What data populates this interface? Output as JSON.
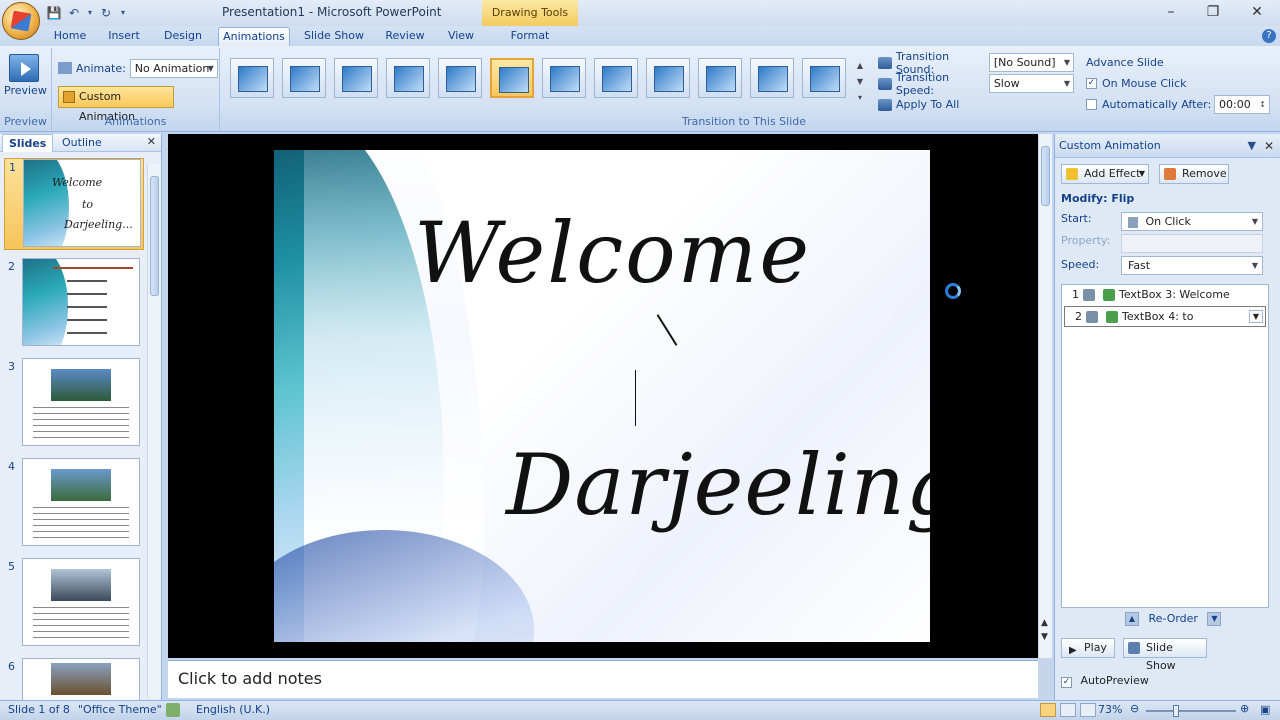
{
  "window": {
    "title": "Presentation1 - Microsoft PowerPoint",
    "contextual_tab_group": "Drawing Tools",
    "controls": [
      "minimize",
      "restore",
      "close"
    ]
  },
  "ribbon_tabs": [
    {
      "label": "Home",
      "active": false
    },
    {
      "label": "Insert",
      "active": false
    },
    {
      "label": "Design",
      "active": false
    },
    {
      "label": "Animations",
      "active": true
    },
    {
      "label": "Slide Show",
      "active": false
    },
    {
      "label": "Review",
      "active": false
    },
    {
      "label": "View",
      "active": false
    },
    {
      "label": "Format",
      "active": false
    }
  ],
  "ribbon": {
    "preview_group": {
      "button_label": "Preview",
      "group_label": "Preview"
    },
    "animations_group": {
      "animate_label": "Animate:",
      "animate_value": "No Animation",
      "custom_animation_label": "Custom Animation",
      "group_label": "Animations"
    },
    "transition_group": {
      "group_label": "Transition to This Slide",
      "selected_index": 5,
      "thumbnail_count": 12
    },
    "transition_options": {
      "sound_label": "Transition Sound:",
      "sound_value": "[No Sound]",
      "speed_label": "Transition Speed:",
      "speed_value": "Slow",
      "apply_all_label": "Apply To All"
    },
    "advance_slide": {
      "title": "Advance Slide",
      "on_mouse_click_label": "On Mouse Click",
      "on_mouse_click_checked": true,
      "auto_after_label": "Automatically After:",
      "auto_after_checked": false,
      "auto_after_value": "00:00"
    }
  },
  "left_pane": {
    "tabs": [
      {
        "label": "Slides",
        "active": true
      },
      {
        "label": "Outline",
        "active": false
      }
    ],
    "slides": [
      {
        "number": "1",
        "selected": true,
        "caption_lines": [
          "Welcome",
          "to",
          "Darjeeling..."
        ]
      },
      {
        "number": "2",
        "selected": false
      },
      {
        "number": "3",
        "selected": false
      },
      {
        "number": "4",
        "selected": false
      },
      {
        "number": "5",
        "selected": false
      },
      {
        "number": "6",
        "selected": false
      }
    ]
  },
  "slide": {
    "title_line": "Welcome",
    "body_line": "Darjeeling..."
  },
  "notes": {
    "placeholder": "Click to add notes"
  },
  "task_pane": {
    "title": "Custom Animation",
    "add_effect_label": "Add Effect",
    "remove_label": "Remove",
    "modify_label": "Modify: Flip",
    "start_label": "Start:",
    "start_value": "On Click",
    "property_label": "Property:",
    "speed_label": "Speed:",
    "speed_value": "Fast",
    "animations": [
      {
        "index": "1",
        "label": "TextBox 3: Welcome",
        "selected": false
      },
      {
        "index": "2",
        "label": "TextBox 4: to",
        "selected": true
      }
    ],
    "reorder_label": "Re-Order",
    "play_label": "Play",
    "slide_show_label": "Slide Show",
    "autopreview_label": "AutoPreview",
    "autopreview_checked": true
  },
  "status_bar": {
    "slide_info": "Slide 1 of 8",
    "theme": "\"Office Theme\"",
    "language": "English (U.K.)",
    "zoom": "73%"
  },
  "colors": {
    "ribbon_bg": "#d3e1f3",
    "accent_selected": "#f9c85b",
    "text_blue": "#15428b",
    "slide_swirl": "#1d8fa3"
  }
}
